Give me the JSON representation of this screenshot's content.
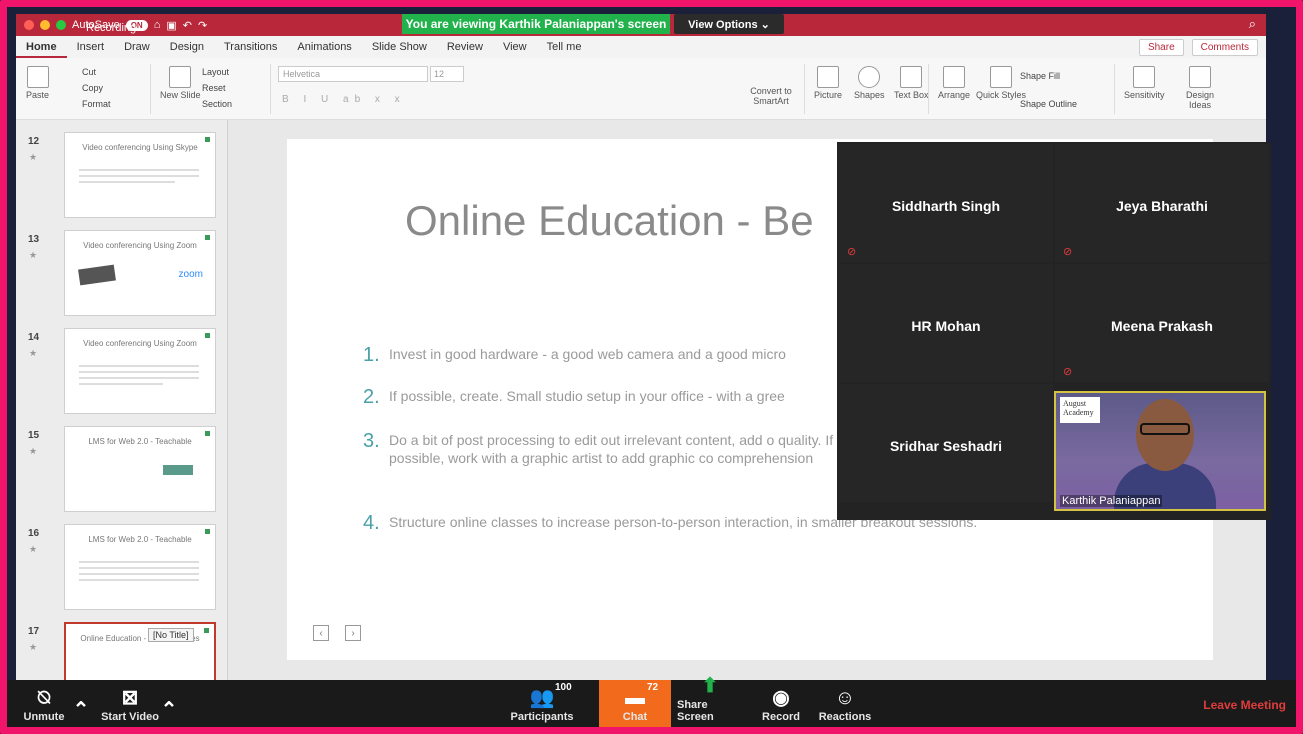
{
  "titlebar": {
    "autosave": "AutoSave",
    "toggle": "ON",
    "recording": "Recording",
    "banner": "You are viewing Karthik Palaniappan's screen",
    "view_options": "View Options ⌄"
  },
  "ribbon_tabs": [
    "Home",
    "Insert",
    "Draw",
    "Design",
    "Transitions",
    "Animations",
    "Slide Show",
    "Review",
    "View",
    "Tell me"
  ],
  "ribbon_right": {
    "share": "Share",
    "comments": "Comments"
  },
  "ribbon": {
    "paste": "Paste",
    "cut": "Cut",
    "copy": "Copy",
    "format": "Format",
    "new_slide": "New Slide",
    "layout": "Layout",
    "reset": "Reset",
    "section": "Section",
    "font": "Helvetica",
    "size": "12",
    "convert": "Convert to SmartArt",
    "picture": "Picture",
    "shapes": "Shapes",
    "textbox": "Text Box",
    "arrange": "Arrange",
    "quick_styles": "Quick Styles",
    "shape_fill": "Shape Fill",
    "shape_outline": "Shape Outline",
    "sensitivity": "Sensitivity",
    "design_ideas": "Design Ideas"
  },
  "thumbnails": [
    {
      "num": "12",
      "title": "Video conferencing Using Skype"
    },
    {
      "num": "13",
      "title": "Video conferencing Using Zoom"
    },
    {
      "num": "14",
      "title": "Video conferencing Using Zoom"
    },
    {
      "num": "15",
      "title": "LMS for Web 2.0 - Teachable"
    },
    {
      "num": "16",
      "title": "LMS for Web 2.0 - Teachable"
    },
    {
      "num": "17",
      "title": "Online Education - Best Practices"
    }
  ],
  "thumb_zoom_text": "zoom",
  "tooltip": "[No Title]",
  "slide": {
    "title": "Online Education - Be",
    "bullets": [
      {
        "n": "1.",
        "text": "Invest in good hardware - a good web camera and a good micro"
      },
      {
        "n": "2.",
        "text": "If possible, create. Small studio setup in your office - with a gree"
      },
      {
        "n": "3.",
        "text": "Do a bit of post processing to edit out irrelevant content, add o quality.  If possible, work with a graphic artist to add graphic co comprehension"
      },
      {
        "n": "4.",
        "text": "Structure online classes to increase person-to-person interaction, in smaller breakout sessions."
      }
    ]
  },
  "participants": [
    {
      "name": "Siddharth Singh",
      "muted": true
    },
    {
      "name": "Jeya Bharathi",
      "muted": true
    },
    {
      "name": "HR Mohan",
      "muted": false
    },
    {
      "name": "Meena Prakash",
      "muted": true
    },
    {
      "name": "Sridhar Seshadri",
      "muted": false
    }
  ],
  "video": {
    "name": "Karthik Palaniappan",
    "logo": "August Academy"
  },
  "toolbar": {
    "unmute": "Unmute",
    "start_video": "Start Video",
    "participants": "Participants",
    "participants_count": "100",
    "chat": "Chat",
    "chat_count": "72",
    "share_screen": "Share Screen",
    "record": "Record",
    "reactions": "Reactions",
    "leave": "Leave Meeting"
  },
  "colors": {
    "frame": "#f0146a",
    "ppt_red": "#b8283a",
    "zoom_green": "#22b24c",
    "chat_orange": "#f26b1d",
    "leave_red": "#e03c3c"
  }
}
